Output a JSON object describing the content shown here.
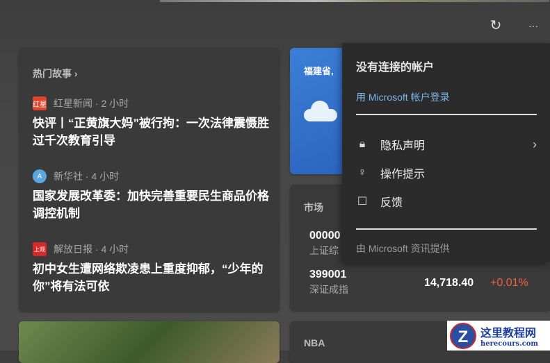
{
  "toolbar": {
    "refresh_icon": "refresh-icon",
    "more_icon": "more-icon",
    "more_label": "···"
  },
  "top_stories": {
    "header": "热门故事",
    "chevron": "›",
    "items": [
      {
        "source": "红星新闻",
        "time": "2 小时",
        "logo_text": "红星",
        "logo_color": "#e0452b",
        "title": "快评丨“正黄旗大妈”被行拘：一次法律震慑胜过千次教育引导"
      },
      {
        "source": "新华社",
        "time": "4 小时",
        "logo_text": "A",
        "logo_color": "#5aa6e0",
        "title": "国家发展改革委：加快完善重要民生商品价格调控机制"
      },
      {
        "source": "解放日报",
        "time": "4 小时",
        "logo_text": "上观",
        "logo_color": "#d42a2a",
        "title": "初中女生遭网络欺凌患上重度抑郁，“少年的你”将有法可依"
      }
    ]
  },
  "weather": {
    "location": "福建省,"
  },
  "market": {
    "header": "市场",
    "rows": [
      {
        "code": "00000",
        "name": "上证综"
      },
      {
        "code": "399001",
        "name": "深证成指",
        "value": "14,718.40",
        "change": "+0.01%",
        "change_color": "#f0623a"
      }
    ]
  },
  "nba": {
    "header": "NBA"
  },
  "flyout": {
    "title": "没有连接的帐户",
    "signin": "用 Microsoft 帐户登录",
    "items": [
      {
        "label": "隐私声明",
        "icon": "lock-icon"
      },
      {
        "label": "操作提示",
        "icon": "lightbulb-icon"
      },
      {
        "label": "反馈",
        "icon": "feedback-icon"
      }
    ],
    "footer": "由 Microsoft 资讯提供"
  },
  "watermark": {
    "name": "这里教程网",
    "url": "herecours.com"
  }
}
